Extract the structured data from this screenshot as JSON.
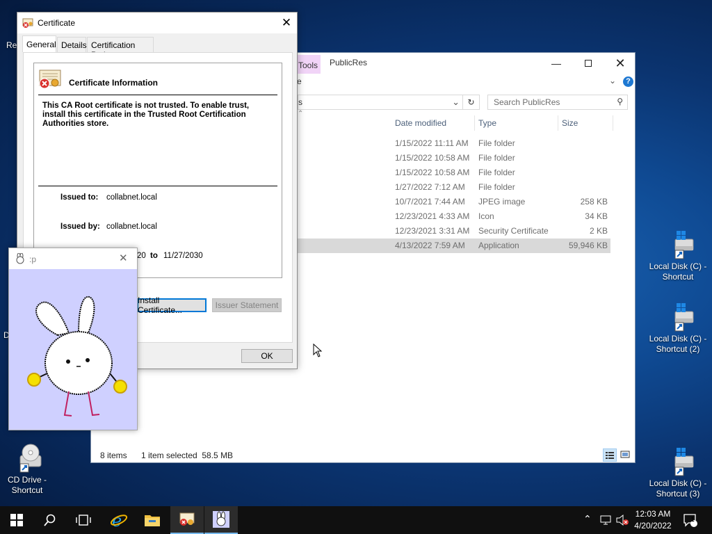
{
  "desktop": {
    "partial_left_top": "Re",
    "partial_left_mid": "D",
    "icons": [
      {
        "label": "Local Disk (C) - Shortcut"
      },
      {
        "label": "Local Disk (C) - Shortcut (2)"
      },
      {
        "label": "Local Disk (C) - Shortcut (3)"
      },
      {
        "label": "CD Drive - Shortcut"
      }
    ]
  },
  "explorer": {
    "tools_tab": "Tools",
    "title": "PublicRes",
    "address_partial": "s",
    "search_placeholder": "Search PublicRes",
    "ribbon_partial": "e",
    "columns": {
      "date": "Date modified",
      "type": "Type",
      "size": "Size"
    },
    "rows": [
      {
        "date": "1/15/2022 11:11 AM",
        "type": "File folder",
        "size": ""
      },
      {
        "date": "1/15/2022 10:58 AM",
        "type": "File folder",
        "size": ""
      },
      {
        "date": "1/15/2022 10:58 AM",
        "type": "File folder",
        "size": ""
      },
      {
        "date": "1/27/2022 7:12 AM",
        "type": "File folder",
        "size": ""
      },
      {
        "date": "10/7/2021 7:44 AM",
        "type": "JPEG image",
        "size": "258 KB"
      },
      {
        "date": "12/23/2021 4:33 AM",
        "type": "Icon",
        "size": "34 KB"
      },
      {
        "date": "12/23/2021 3:31 AM",
        "type": "Security Certificate",
        "size": "2 KB"
      },
      {
        "date": "4/13/2022 7:59 AM",
        "type": "Application",
        "size": "59,946 KB"
      }
    ],
    "status_items": "8 items",
    "status_selected": "1 item selected  58.5 MB"
  },
  "certificate": {
    "title": "Certificate",
    "tabs": [
      "General",
      "Details",
      "Certification Path"
    ],
    "info_heading": "Certificate Information",
    "warning_text": "This CA Root certificate is not trusted. To enable trust, install this certificate in the Trusted Root Certification Authorities store.",
    "issued_to_label": "Issued to:",
    "issued_to_value": "collabnet.local",
    "issued_by_label": "Issued by:",
    "issued_by_value": "collabnet.local",
    "valid_partial_from": "20",
    "valid_to_word": "to",
    "valid_to_value": "11/27/2030",
    "install_button": "Install Certificate...",
    "issuer_statement_button": "Issuer Statement",
    "ok_button": "OK"
  },
  "image_window": {
    "title": ":p"
  },
  "taskbar": {
    "time": "12:03 AM",
    "date": "4/20/2022",
    "notification_count": "1"
  }
}
